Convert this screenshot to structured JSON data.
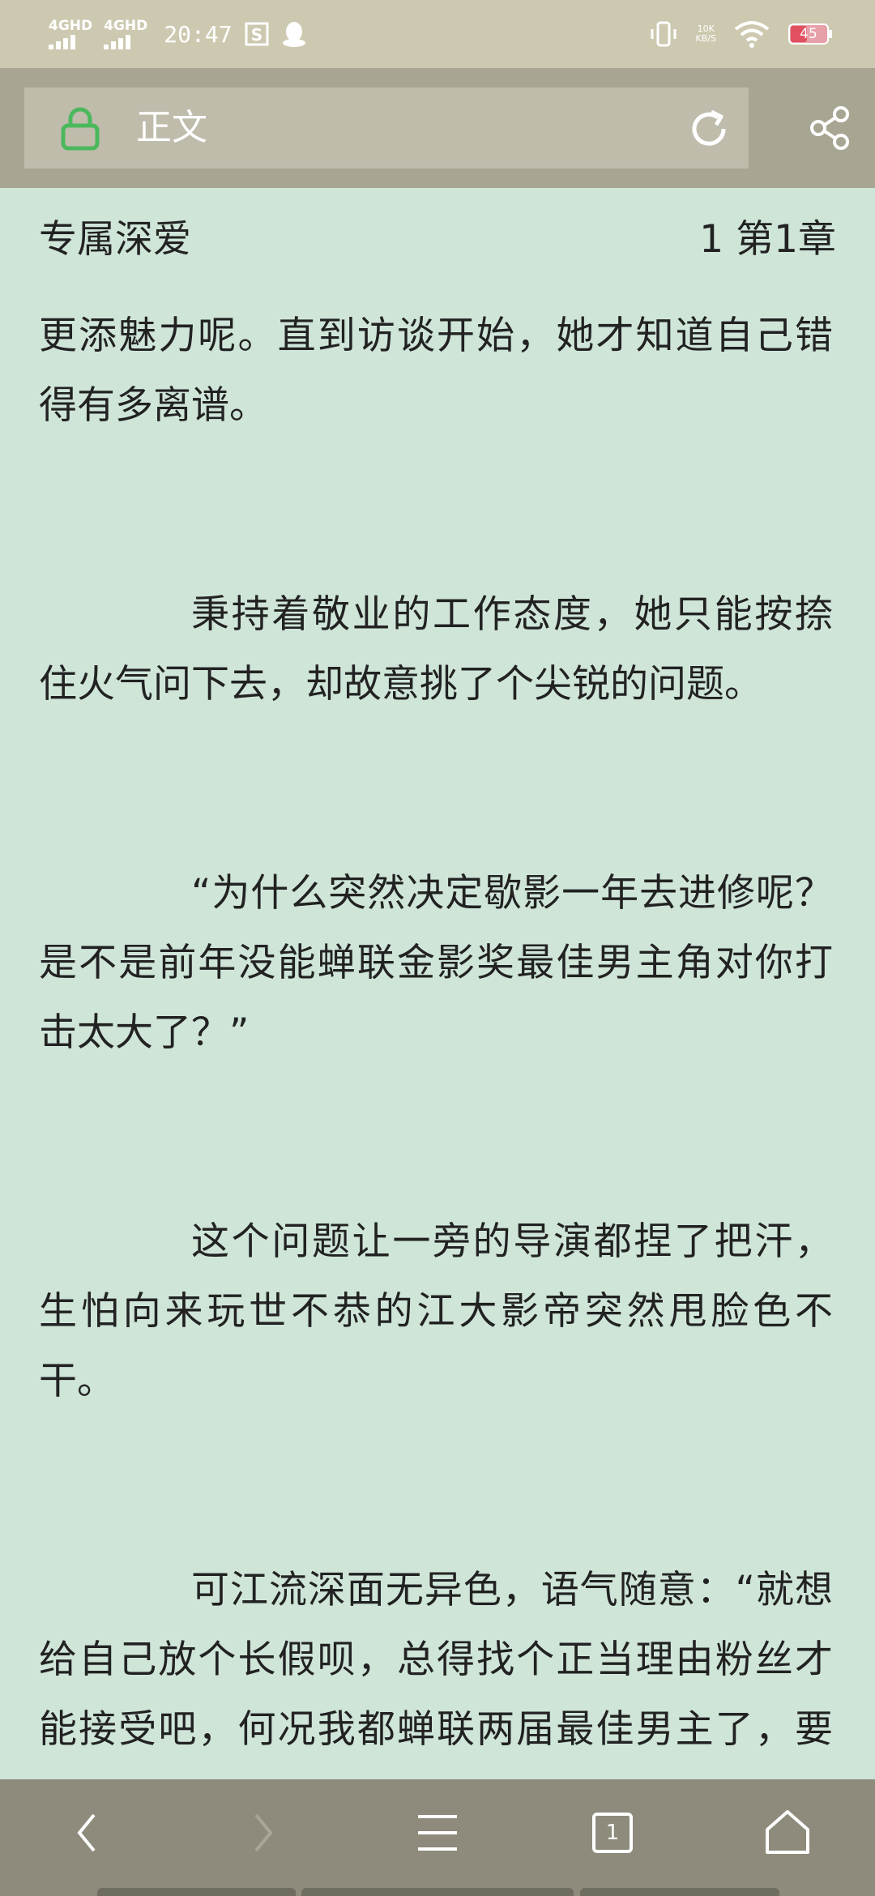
{
  "status_bar": {
    "signal1": "4GHD",
    "signal2": "4GHD",
    "time": "20:47",
    "speed_value": "10K",
    "speed_unit": "KB/S",
    "battery": "45"
  },
  "toolbar": {
    "title": "正文"
  },
  "reader": {
    "book_title": "专属深爱",
    "chapter": "1 第1章",
    "paragraphs": [
      "更添魅力呢。直到访谈开始，她才知道自己错得有多离谱。",
      "秉持着敬业的工作态度，她只能按捺住火气问下去，却故意挑了个尖锐的问题。",
      "“为什么突然决定歇影一年去进修呢？是不是前年没能蝉联金影奖最佳男主角对你打击太大了？”",
      "这个问题让一旁的导演都捏了把汗，生怕向来玩世不恭的江大影帝突然甩脸色不干。",
      "可江流深面无异色，语气随意：“就想给自己放个长假呗，总得找个正当理由粉丝才能接受吧，何况我都蝉联两届最佳男主了，要是再赢一届，我怕其他人都"
    ]
  },
  "bottom_nav": {
    "tab_count": "1"
  }
}
